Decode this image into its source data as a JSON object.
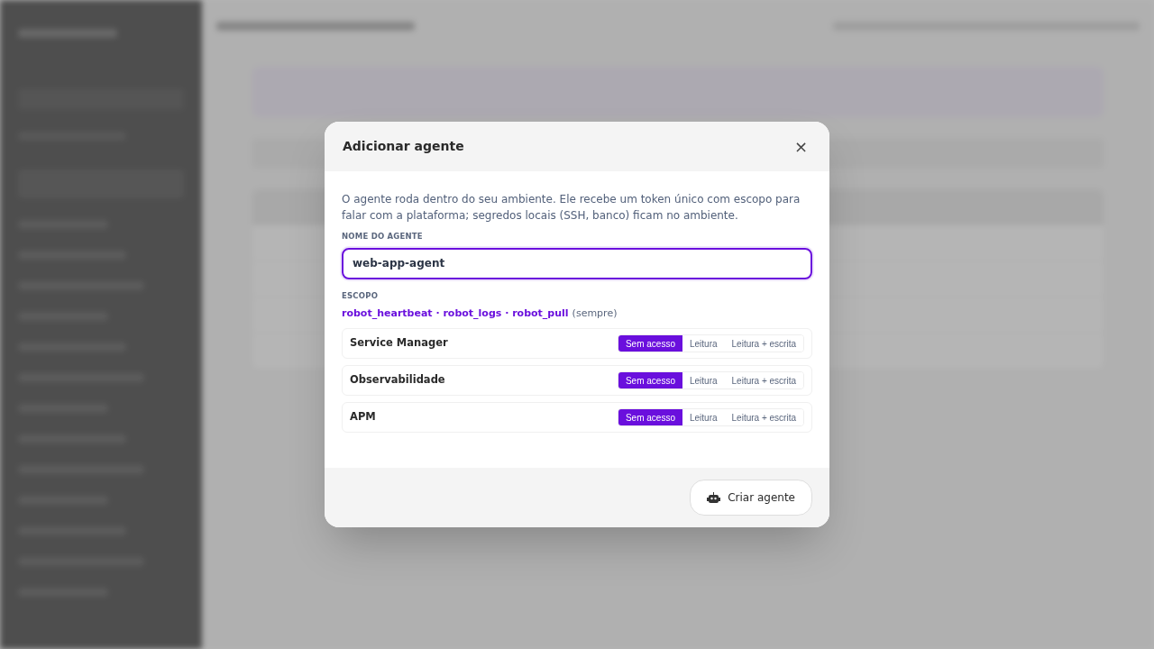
{
  "dialog": {
    "title": "Adicionar agente",
    "close": "×",
    "description": "O agente roda dentro do seu ambiente. Ele recebe um token único com escopo para falar com a plataforma; segredos locais (SSH, banco) ficam no ambiente.",
    "name_field": {
      "label": "NOME DO AGENTE",
      "value": "web-app-agent",
      "focused": true
    },
    "scope": {
      "label": "ESCOPO",
      "fixed": "robot_heartbeat · robot_logs · robot_pull",
      "note": "(sempre)"
    },
    "permissions": [
      {
        "module": "Service Manager",
        "options": [
          {
            "label": "Sem acesso",
            "selected": true
          },
          {
            "label": "Leitura",
            "selected": false
          },
          {
            "label": "Leitura + escrita",
            "selected": false
          }
        ]
      },
      {
        "module": "Observabilidade",
        "options": [
          {
            "label": "Sem acesso",
            "selected": true
          },
          {
            "label": "Leitura",
            "selected": false
          },
          {
            "label": "Leitura + escrita",
            "selected": false
          }
        ]
      },
      {
        "module": "APM",
        "options": [
          {
            "label": "Sem acesso",
            "selected": true
          },
          {
            "label": "Leitura",
            "selected": false
          },
          {
            "label": "Leitura + escrita",
            "selected": false
          }
        ]
      }
    ],
    "submit": "Criar agente"
  }
}
